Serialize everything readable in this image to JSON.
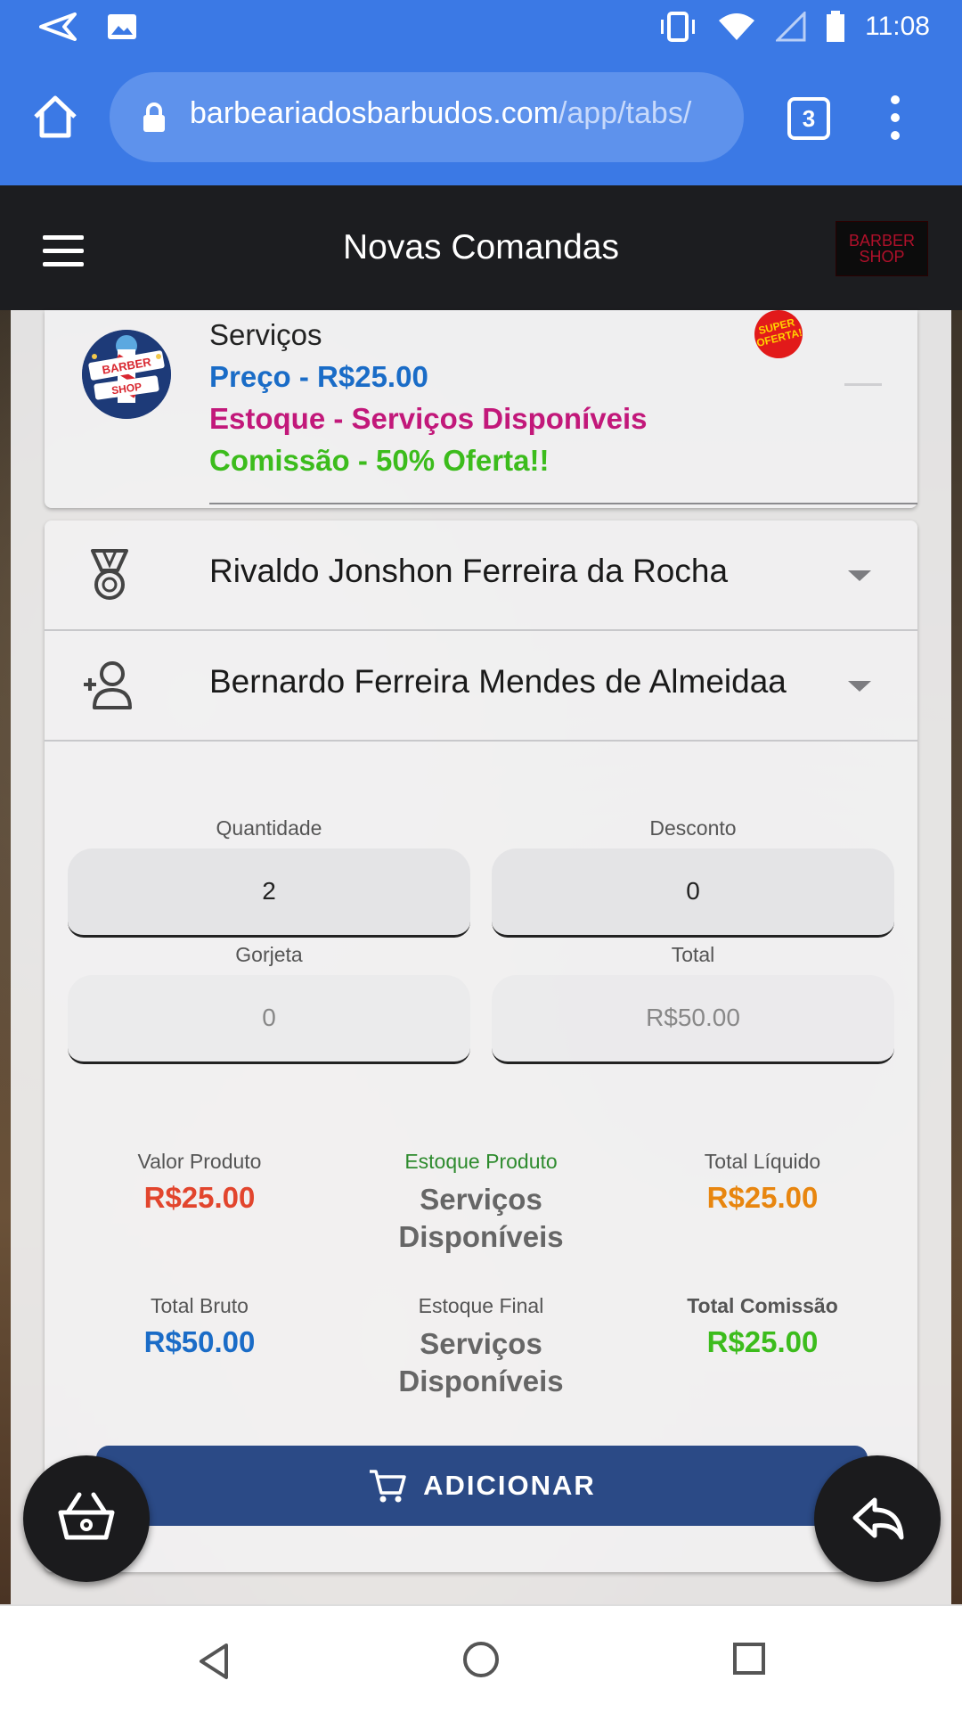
{
  "status_bar": {
    "time": "11:08"
  },
  "browser": {
    "url_main": "barbeariadosbarbudos.com",
    "url_path": "/app/tabs/",
    "tab_count": "3"
  },
  "header": {
    "title": "Novas Comandas",
    "logo_text": "BARBER SHOP"
  },
  "product": {
    "title": "Serviços",
    "price": "Preço - R$25.00",
    "stock": "Estoque - Serviços Disponíveis",
    "commission": "Comissão - 50% Oferta!!",
    "badge": "SUPER OFERTA!",
    "avatar_text_1": "BARBER",
    "avatar_text_2": "SHOP"
  },
  "selects": {
    "barber": "Rivaldo Jonshon Ferreira da Rocha",
    "client": "Bernardo Ferreira Mendes de Almeidaa"
  },
  "fields": {
    "quantidade_label": "Quantidade",
    "quantidade_value": "2",
    "desconto_label": "Desconto",
    "desconto_value": "0",
    "gorjeta_label": "Gorjeta",
    "gorjeta_value": "0",
    "total_label": "Total",
    "total_value": "R$50.00"
  },
  "stats": {
    "valor_produto_label": "Valor Produto",
    "valor_produto_value": "R$25.00",
    "estoque_produto_label": "Estoque Produto",
    "estoque_produto_value_1": "Serviços",
    "estoque_produto_value_2": "Disponíveis",
    "total_liquido_label": "Total Líquido",
    "total_liquido_value": "R$25.00",
    "total_bruto_label": "Total Bruto",
    "total_bruto_value": "R$50.00",
    "estoque_final_label": "Estoque Final",
    "estoque_final_value_1": "Serviços",
    "estoque_final_value_2": "Disponíveis",
    "total_comissao_label": "Total Comissão",
    "total_comissao_value": "R$25.00"
  },
  "actions": {
    "add_label": "ADICIONAR"
  },
  "colors": {
    "accent_blue": "#1a6cc7",
    "stock_magenta": "#c2187a",
    "commission_green": "#3cbc1c",
    "valor_red": "#e2452d",
    "liquido_orange": "#e8860f",
    "button_navy": "#2b4a86"
  },
  "icons": {
    "status_left": [
      "send-icon",
      "image-icon"
    ],
    "status_right": [
      "vibrate-icon",
      "wifi-icon",
      "signal-icon",
      "battery-icon"
    ],
    "fab_left": "basket-icon",
    "fab_right": "reply-icon"
  }
}
